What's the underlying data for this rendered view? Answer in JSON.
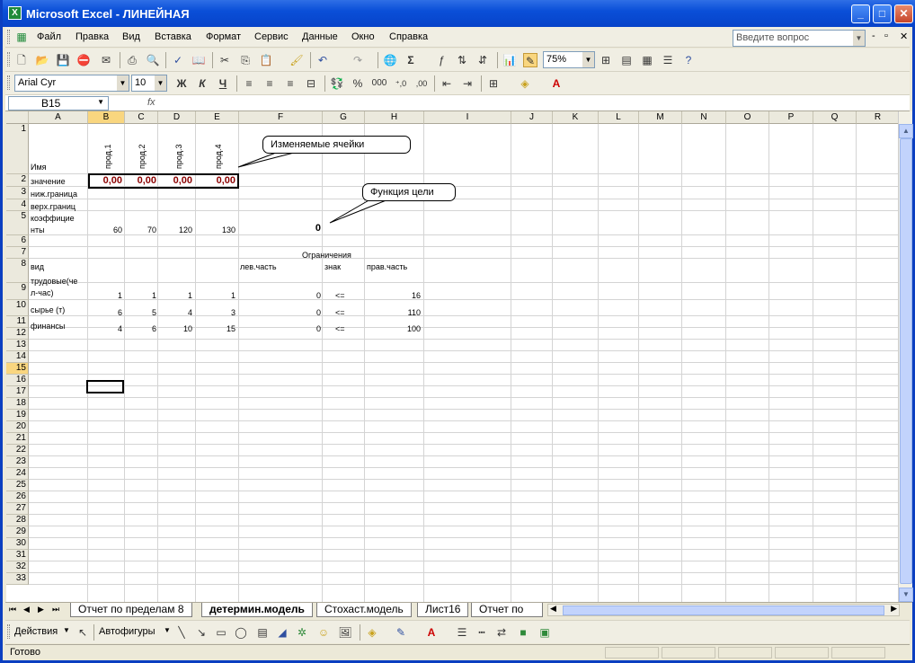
{
  "window": {
    "title": "Microsoft Excel - ЛИНЕЙНАЯ"
  },
  "menu": [
    "Файл",
    "Правка",
    "Вид",
    "Вставка",
    "Формат",
    "Сервис",
    "Данные",
    "Окно",
    "Справка"
  ],
  "help_placeholder": "Введите вопрос",
  "zoom": "75%",
  "font": {
    "name": "Arial Cyr",
    "size": "10"
  },
  "format_buttons": {
    "bold": "Ж",
    "italic": "К",
    "underline": "Ч",
    "percent": "%",
    "thousands": "000",
    "inc_dec": "⁺,0",
    "dec_dec": ",00"
  },
  "formula_bar": {
    "cell_ref": "B15",
    "fx": "fx",
    "value": ""
  },
  "columns": [
    "A",
    "B",
    "C",
    "D",
    "E",
    "F",
    "G",
    "H",
    "I",
    "J",
    "K",
    "L",
    "M",
    "N",
    "O",
    "P",
    "Q",
    "R"
  ],
  "rows": [
    "1",
    "2",
    "3",
    "4",
    "5",
    "6",
    "7",
    "8",
    "9",
    "10",
    "11",
    "12",
    "13",
    "14",
    "15",
    "16",
    "17",
    "18",
    "19",
    "20",
    "21",
    "22",
    "23",
    "24",
    "25",
    "26",
    "27",
    "28",
    "29",
    "30",
    "31",
    "32",
    "33"
  ],
  "sheet": {
    "a1": "Имя",
    "headers_vertical": [
      "прод.1",
      "прод.2",
      "прод.3",
      "прод.4"
    ],
    "a2": "значение",
    "values_row2": [
      "0,00",
      "0,00",
      "0,00",
      "0,00"
    ],
    "a3": "ниж.граница",
    "a4": "верх.границ",
    "a5_line1": "коэффицие",
    "a5_line2": "нты",
    "coeffs": [
      "60",
      "70",
      "120",
      "130"
    ],
    "f5": "0",
    "f6": "Ограничения",
    "a7": "вид",
    "f7": "лев.часть",
    "g7": "знак",
    "h7": "прав.часть",
    "rows_constraints": [
      {
        "name1": "трудовые(че",
        "name2": "л-час)",
        "vals": [
          "1",
          "1",
          "1",
          "1"
        ],
        "lhs": "0",
        "sign": "<=",
        "rhs": "16"
      },
      {
        "name1": "сырье (т)",
        "name2": "",
        "vals": [
          "6",
          "5",
          "4",
          "3"
        ],
        "lhs": "0",
        "sign": "<=",
        "rhs": "110"
      },
      {
        "name1": "финансы",
        "name2": "",
        "vals": [
          "4",
          "6",
          "10",
          "15"
        ],
        "lhs": "0",
        "sign": "<=",
        "rhs": "100"
      }
    ]
  },
  "callouts": {
    "changing": "Изменяемые ячейки",
    "target": "Функция цели"
  },
  "tabs": [
    "Отчет по пределам 8",
    "детермин.модель",
    "Стохаст.модель",
    "Лист16",
    "Отчет по пр"
  ],
  "draw": {
    "actions": "Действия",
    "autoshapes": "Автофигуры"
  },
  "status": "Готово",
  "colors": {
    "title": "#0a4fd8",
    "selected_header": "#f9d67f",
    "value_red": "#8b0000"
  }
}
